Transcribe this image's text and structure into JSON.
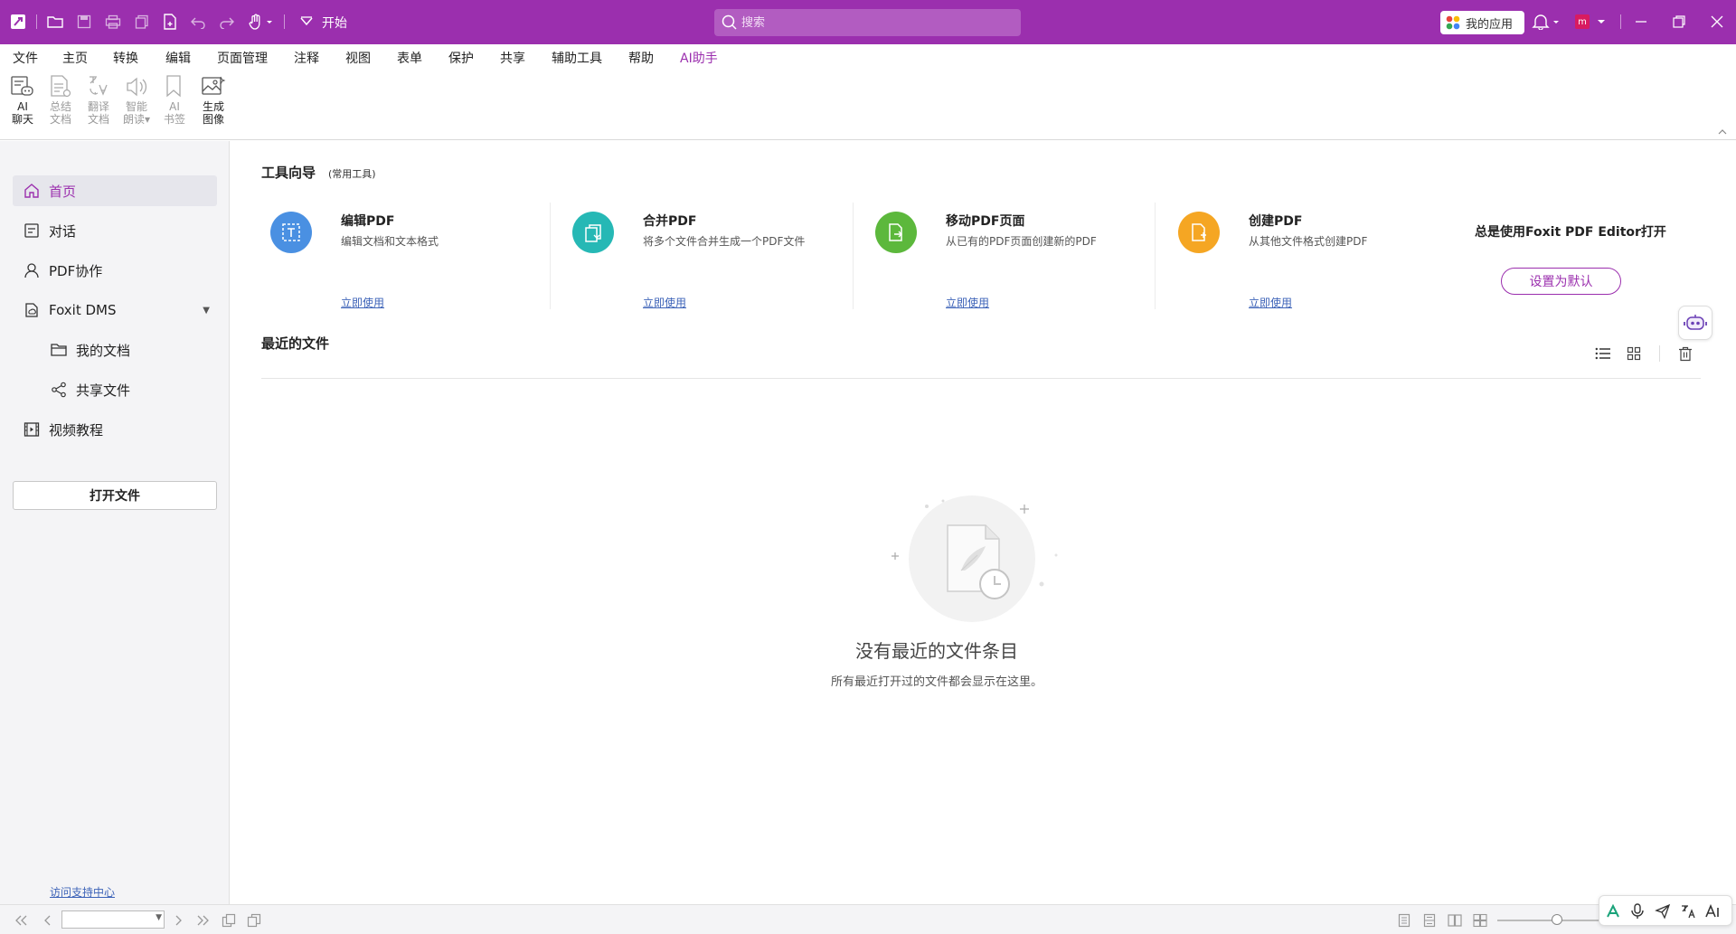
{
  "titlebar": {
    "start_label": "开始",
    "search_placeholder": "搜索",
    "my_apps": "我的应用",
    "avatar_letter": "m",
    "accent_color": "#9b2fae"
  },
  "menu": {
    "items": [
      "文件",
      "主页",
      "转换",
      "编辑",
      "页面管理",
      "注释",
      "视图",
      "表单",
      "保护",
      "共享",
      "辅助工具",
      "帮助",
      "AI助手"
    ],
    "active": "AI助手"
  },
  "ribbon": {
    "buttons": [
      {
        "label": "AI\n聊天",
        "icon": "ai-chat-icon"
      },
      {
        "label": "总结\n文档",
        "icon": "summarize-doc-icon"
      },
      {
        "label": "翻译\n文档",
        "icon": "translate-doc-icon"
      },
      {
        "label": "智能\n朗读▾",
        "icon": "smart-read-icon"
      },
      {
        "label": "AI\n书签",
        "icon": "ai-bookmark-icon"
      },
      {
        "label": "生成\n图像",
        "icon": "generate-image-icon"
      }
    ]
  },
  "sidebar": {
    "items": [
      {
        "label": "首页",
        "icon": "home-icon"
      },
      {
        "label": "对话",
        "icon": "chat-icon"
      },
      {
        "label": "PDF协作",
        "icon": "user-icon"
      },
      {
        "label": "Foxit DMS",
        "icon": "dms-icon"
      },
      {
        "label": "我的文档",
        "icon": "folder-icon"
      },
      {
        "label": "共享文件",
        "icon": "share-icon"
      },
      {
        "label": "视频教程",
        "icon": "video-icon"
      }
    ],
    "open_file": "打开文件",
    "support_link": "访问支持中心"
  },
  "main": {
    "guide_title": "工具向导",
    "guide_subtitle": "(常用工具)",
    "tools": [
      {
        "title": "编辑PDF",
        "desc": "编辑文档和文本格式",
        "action": "立即使用",
        "color": "#4a90e2"
      },
      {
        "title": "合并PDF",
        "desc": "将多个文件合并生成一个PDF文件",
        "action": "立即使用",
        "color": "#26b8b5"
      },
      {
        "title": "移动PDF页面",
        "desc": "从已有的PDF页面创建新的PDF",
        "action": "立即使用",
        "color": "#5cb83c"
      },
      {
        "title": "创建PDF",
        "desc": "从其他文件格式创建PDF",
        "action": "立即使用",
        "color": "#f5a623"
      }
    ],
    "default_text": "总是使用Foxit PDF Editor打开",
    "default_button": "设置为默认",
    "recent_title": "最近的文件",
    "empty_title": "没有最近的文件条目",
    "empty_subtitle": "所有最近打开过的文件都会显示在这里。"
  }
}
